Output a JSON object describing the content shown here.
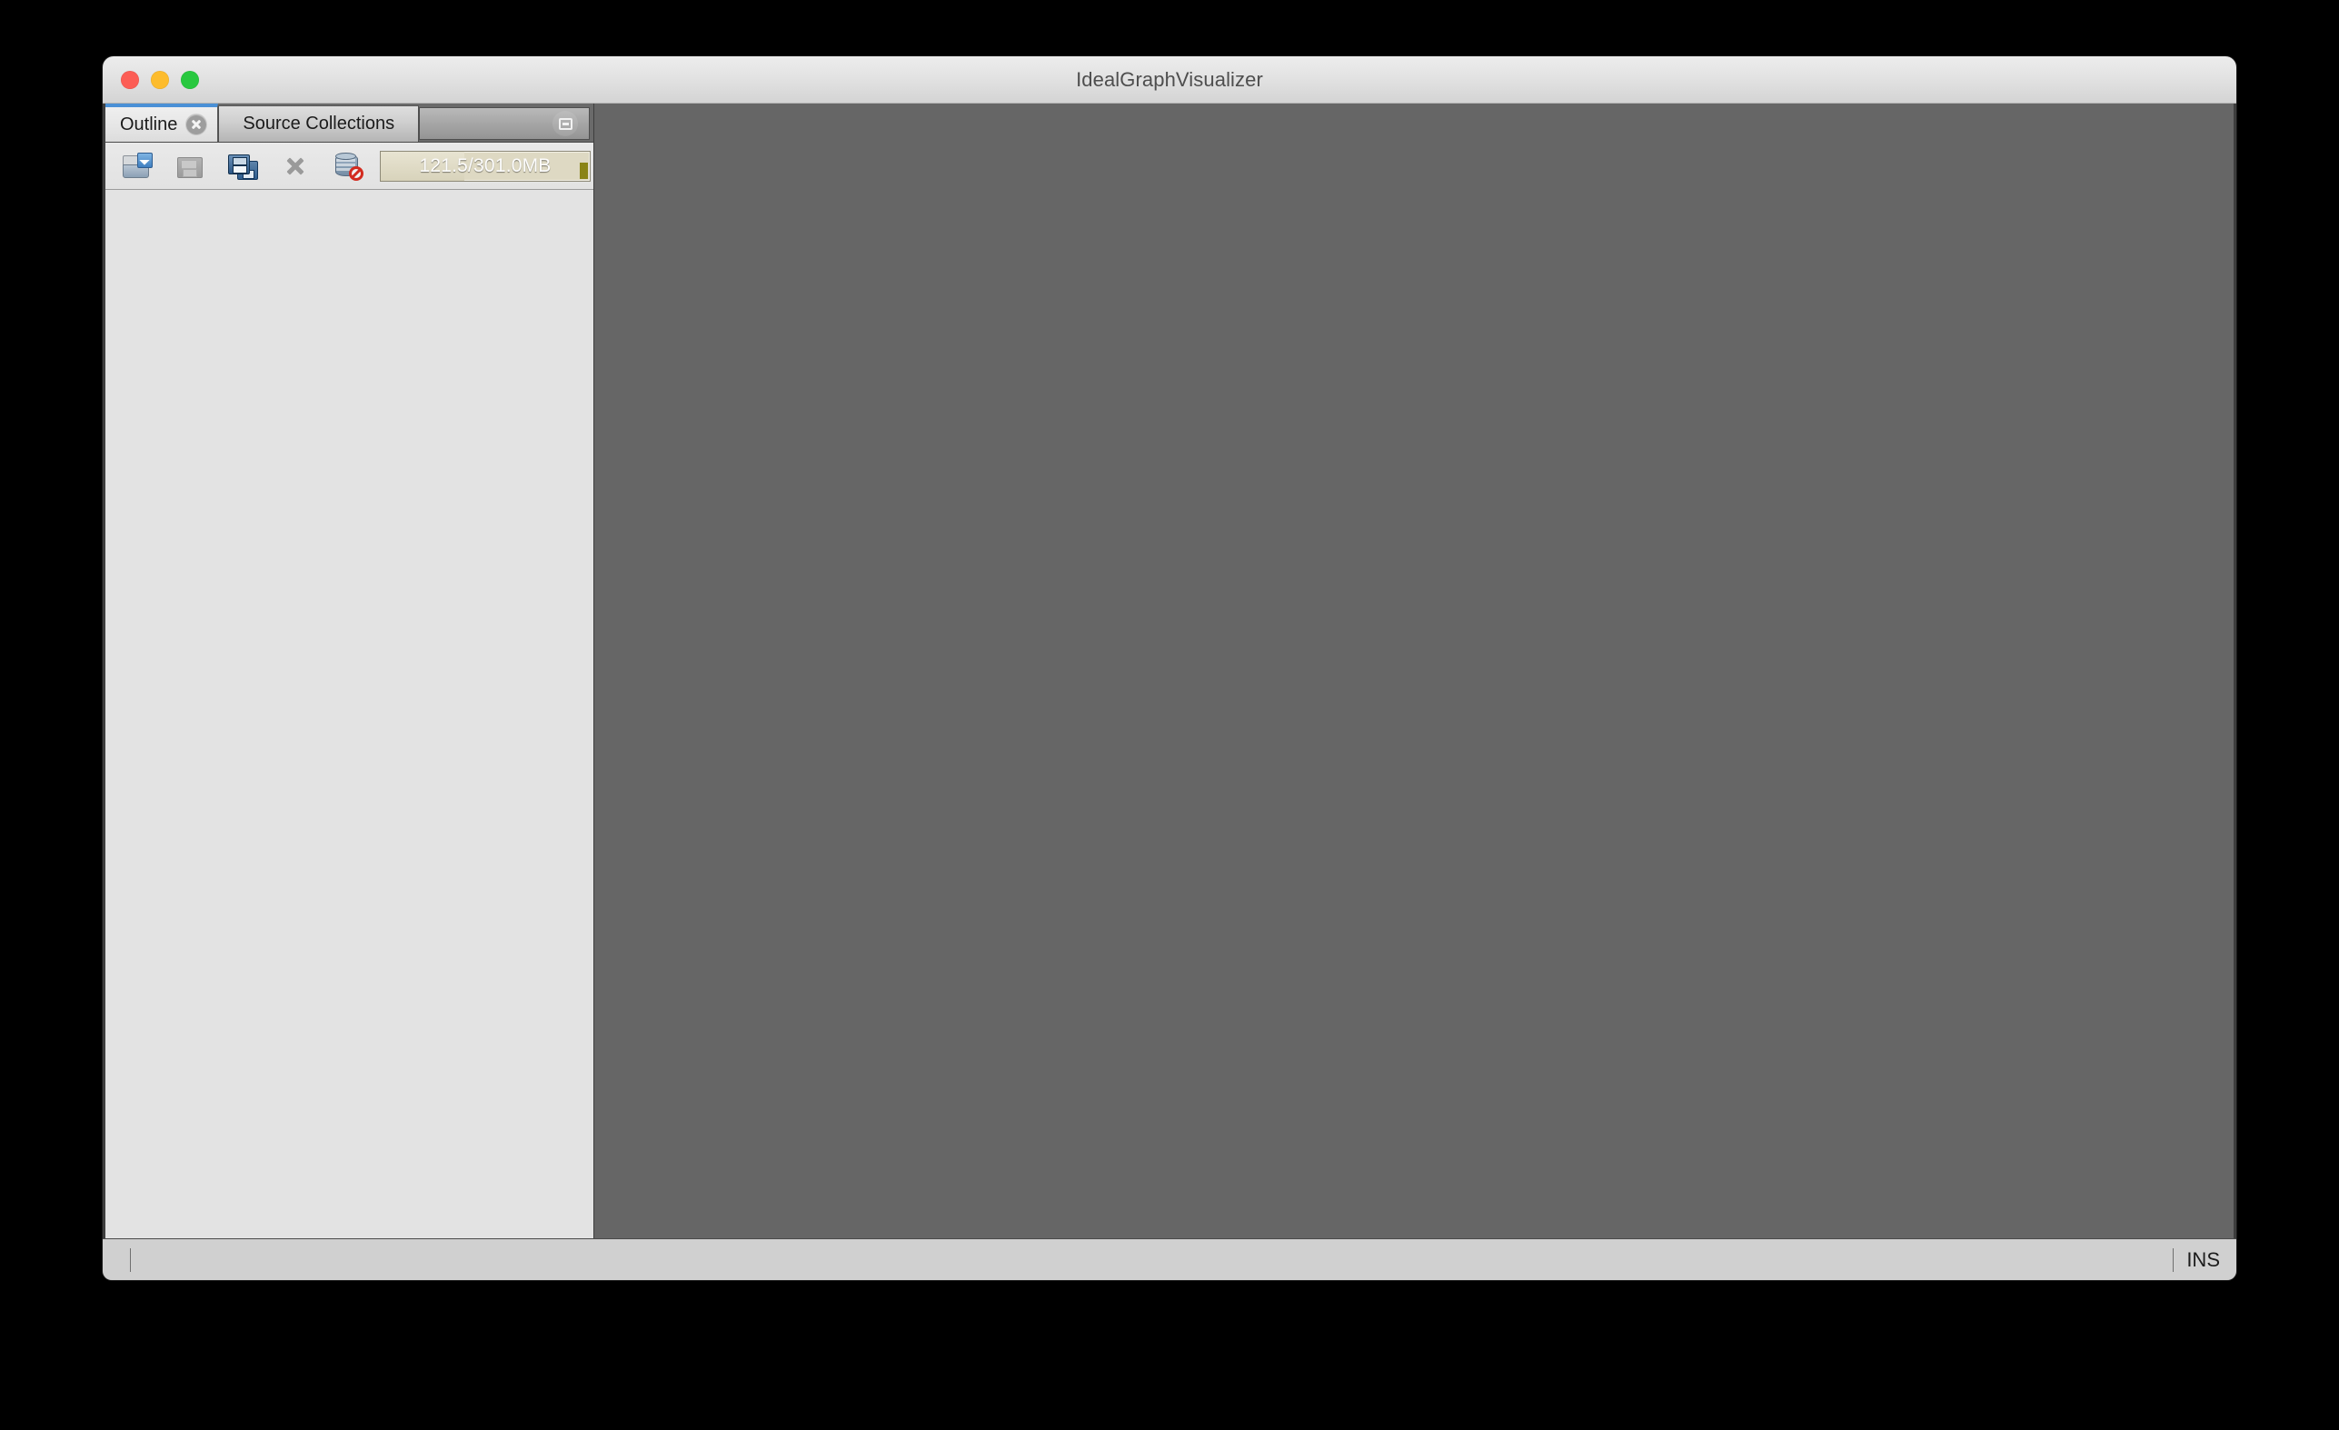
{
  "window": {
    "title": "IdealGraphVisualizer",
    "traffic_lights": [
      {
        "name": "close",
        "color": "#fc5d55"
      },
      {
        "name": "minimize",
        "color": "#fdbc2d"
      },
      {
        "name": "maximize",
        "color": "#28c83f"
      }
    ]
  },
  "left_dock": {
    "tabs": [
      {
        "label": "Outline",
        "active": true,
        "closable": true
      },
      {
        "label": "Source Collections",
        "active": false,
        "closable": false
      }
    ],
    "dock_minimize_icon": "minimize-window-icon",
    "toolbar": {
      "buttons": [
        {
          "name": "open-import-icon",
          "tooltip": "Open"
        },
        {
          "name": "save-icon",
          "tooltip": "Save",
          "disabled": true
        },
        {
          "name": "save-all-icon",
          "tooltip": "Save All"
        },
        {
          "name": "remove-icon",
          "tooltip": "Remove",
          "disabled": true
        },
        {
          "name": "database-disconnect-icon",
          "tooltip": "Disconnect"
        }
      ]
    },
    "memory_gauge": {
      "text": "121.5/301.0MB",
      "used_mb": 121.5,
      "total_mb": 301.0,
      "percent": 40
    }
  },
  "editor": {
    "background_color": "#666666"
  },
  "status_bar": {
    "insert_mode": "INS"
  },
  "colors": {
    "accent_tab": "#4a90d6",
    "editor_background": "#666666",
    "panel_background": "#e3e3e3",
    "status_background": "#d0d0d0",
    "gauge_fill": "#d8d3bb"
  }
}
